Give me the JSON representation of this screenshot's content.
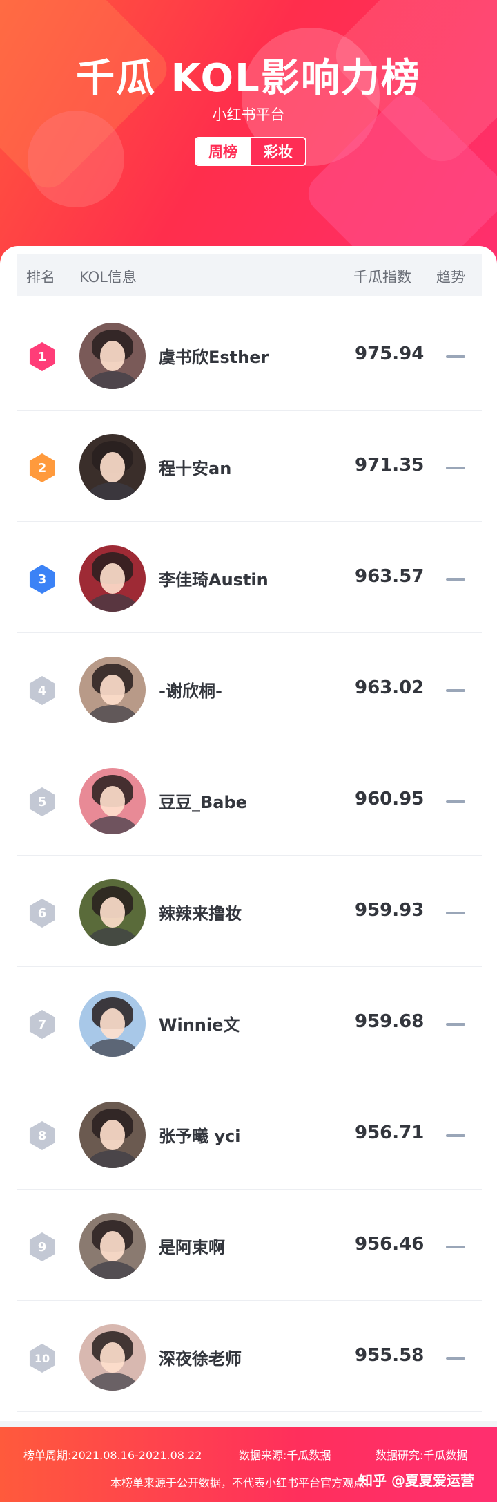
{
  "header": {
    "title": "千瓜 KOL影响力榜",
    "subtitle": "小红书平台",
    "tabs": [
      "周榜",
      "彩妆"
    ]
  },
  "table": {
    "columns": [
      "排名",
      "KOL信息",
      "千瓜指数",
      "趋势"
    ],
    "rows": [
      {
        "rank": "1",
        "name": "虞书欣Esther",
        "score": "975.94",
        "trend": "flat",
        "badge_color": "#ff3d78",
        "avatar_bg": "#7a5a58"
      },
      {
        "rank": "2",
        "name": "程十安an",
        "score": "971.35",
        "trend": "flat",
        "badge_color": "#ff9a3c",
        "avatar_bg": "#3a2e2a"
      },
      {
        "rank": "3",
        "name": "李佳琦Austin",
        "score": "963.57",
        "trend": "flat",
        "badge_color": "#3b82f6",
        "avatar_bg": "#9e2a35"
      },
      {
        "rank": "4",
        "name": "-谢欣桐-",
        "score": "963.02",
        "trend": "flat",
        "badge_color": "#c3c8d4",
        "avatar_bg": "#b89a88"
      },
      {
        "rank": "5",
        "name": "豆豆_Babe",
        "score": "960.95",
        "trend": "flat",
        "badge_color": "#c3c8d4",
        "avatar_bg": "#e88a96"
      },
      {
        "rank": "6",
        "name": "辣辣来撸妆",
        "score": "959.93",
        "trend": "flat",
        "badge_color": "#c3c8d4",
        "avatar_bg": "#5a6b3a"
      },
      {
        "rank": "7",
        "name": "Winnie文",
        "score": "959.68",
        "trend": "flat",
        "badge_color": "#c3c8d4",
        "avatar_bg": "#a8c8e8"
      },
      {
        "rank": "8",
        "name": "张予曦 yci",
        "score": "956.71",
        "trend": "flat",
        "badge_color": "#c3c8d4",
        "avatar_bg": "#6b5a50"
      },
      {
        "rank": "9",
        "name": "是阿束啊",
        "score": "956.46",
        "trend": "flat",
        "badge_color": "#c3c8d4",
        "avatar_bg": "#8a7a70"
      },
      {
        "rank": "10",
        "name": "深夜徐老师",
        "score": "955.58",
        "trend": "flat",
        "badge_color": "#c3c8d4",
        "avatar_bg": "#d8b8b0"
      }
    ]
  },
  "footer": {
    "period": "榜单周期:2021.08.16-2021.08.22",
    "source": "数据来源:千瓜数据",
    "research": "数据研究:千瓜数据",
    "disclaimer": "本榜单来源于公开数据，不代表小红书平台官方观点",
    "watermark": "知乎 @夏夏爱运营"
  }
}
